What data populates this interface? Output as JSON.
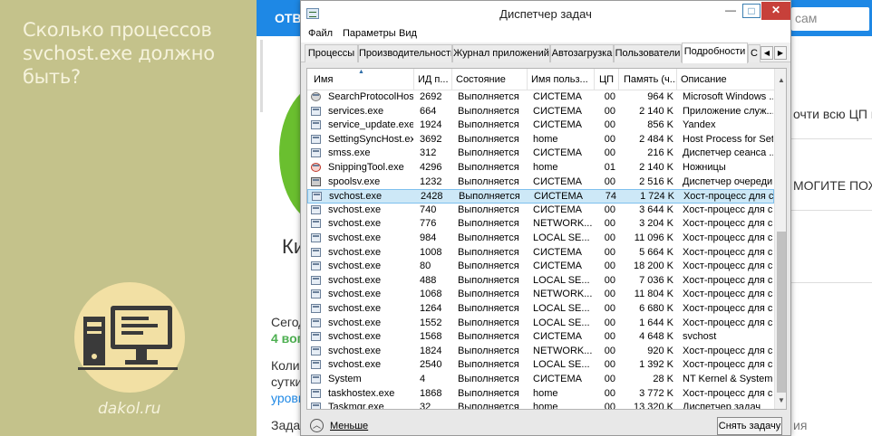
{
  "banner": {
    "title": "Сколько процессов svchost.exe должно быть?",
    "site": "dakol.ru"
  },
  "background_page": {
    "top_button": "ОТВ",
    "search_placeholder": "сам",
    "text_ki": "Ки",
    "text_right_1": "очти всю ЦП гру",
    "text_right_2": "МОГИТЕ ПОЖА",
    "text_left_1": "Сегод",
    "text_left_2": "4 воп",
    "text_left_3": "Колич",
    "text_left_4": "сутки",
    "text_left_5": "уровн",
    "text_left_6": "Задач",
    "text_right_bottom": "ия"
  },
  "window": {
    "title": "Диспетчер задач",
    "min_label": "—",
    "max_label": "□",
    "close_label": "✕",
    "menu": [
      "Файл",
      "Параметры",
      "Вид"
    ],
    "tabs": [
      "Процессы",
      "Производительность",
      "Журнал приложений",
      "Автозагрузка",
      "Пользователи",
      "Подробности",
      "С"
    ],
    "active_tab": "Подробности",
    "columns": [
      "Имя",
      "ИД п...",
      "Состояние",
      "Имя польз...",
      "ЦП",
      "Память (ч...",
      "Описание"
    ],
    "rows": [
      {
        "icon": "search-icon",
        "name": "SearchProtocolHost...",
        "pid": "2692",
        "state": "Выполняется",
        "user": "СИСТЕМА",
        "cpu": "00",
        "mem": "964 K",
        "desc": "Microsoft Windows ..."
      },
      {
        "icon": "process-icon",
        "name": "services.exe",
        "pid": "664",
        "state": "Выполняется",
        "user": "СИСТЕМА",
        "cpu": "00",
        "mem": "2 140 K",
        "desc": "Приложение служ..."
      },
      {
        "icon": "process-icon",
        "name": "service_update.exe",
        "pid": "1924",
        "state": "Выполняется",
        "user": "СИСТЕМА",
        "cpu": "00",
        "mem": "856 K",
        "desc": "Yandex"
      },
      {
        "icon": "process-icon",
        "name": "SettingSyncHost.exe",
        "pid": "3692",
        "state": "Выполняется",
        "user": "home",
        "cpu": "00",
        "mem": "2 484 K",
        "desc": "Host Process for Set..."
      },
      {
        "icon": "process-icon",
        "name": "smss.exe",
        "pid": "312",
        "state": "Выполняется",
        "user": "СИСТЕМА",
        "cpu": "00",
        "mem": "216 K",
        "desc": "Диспетчер сеанса ..."
      },
      {
        "icon": "scissors-icon",
        "name": "SnippingTool.exe",
        "pid": "4296",
        "state": "Выполняется",
        "user": "home",
        "cpu": "01",
        "mem": "2 140 K",
        "desc": "Ножницы"
      },
      {
        "icon": "printer-icon",
        "name": "spoolsv.exe",
        "pid": "1232",
        "state": "Выполняется",
        "user": "СИСТЕМА",
        "cpu": "00",
        "mem": "2 516 K",
        "desc": "Диспетчер очереди..."
      },
      {
        "icon": "process-icon",
        "name": "svchost.exe",
        "pid": "2428",
        "state": "Выполняется",
        "user": "СИСТЕМА",
        "cpu": "74",
        "mem": "1 724 K",
        "desc": "Хост-процесс для с...",
        "selected": true
      },
      {
        "icon": "process-icon",
        "name": "svchost.exe",
        "pid": "740",
        "state": "Выполняется",
        "user": "СИСТЕМА",
        "cpu": "00",
        "mem": "3 644 K",
        "desc": "Хост-процесс для с..."
      },
      {
        "icon": "process-icon",
        "name": "svchost.exe",
        "pid": "776",
        "state": "Выполняется",
        "user": "NETWORK...",
        "cpu": "00",
        "mem": "3 204 K",
        "desc": "Хост-процесс для с..."
      },
      {
        "icon": "process-icon",
        "name": "svchost.exe",
        "pid": "984",
        "state": "Выполняется",
        "user": "LOCAL SE...",
        "cpu": "00",
        "mem": "11 096 K",
        "desc": "Хост-процесс для с..."
      },
      {
        "icon": "process-icon",
        "name": "svchost.exe",
        "pid": "1008",
        "state": "Выполняется",
        "user": "СИСТЕМА",
        "cpu": "00",
        "mem": "5 664 K",
        "desc": "Хост-процесс для с..."
      },
      {
        "icon": "process-icon",
        "name": "svchost.exe",
        "pid": "80",
        "state": "Выполняется",
        "user": "СИСТЕМА",
        "cpu": "00",
        "mem": "18 200 K",
        "desc": "Хост-процесс для с..."
      },
      {
        "icon": "process-icon",
        "name": "svchost.exe",
        "pid": "488",
        "state": "Выполняется",
        "user": "LOCAL SE...",
        "cpu": "00",
        "mem": "7 036 K",
        "desc": "Хост-процесс для с..."
      },
      {
        "icon": "process-icon",
        "name": "svchost.exe",
        "pid": "1068",
        "state": "Выполняется",
        "user": "NETWORK...",
        "cpu": "00",
        "mem": "11 804 K",
        "desc": "Хост-процесс для с..."
      },
      {
        "icon": "process-icon",
        "name": "svchost.exe",
        "pid": "1264",
        "state": "Выполняется",
        "user": "LOCAL SE...",
        "cpu": "00",
        "mem": "6 680 K",
        "desc": "Хост-процесс для с..."
      },
      {
        "icon": "process-icon",
        "name": "svchost.exe",
        "pid": "1552",
        "state": "Выполняется",
        "user": "LOCAL SE...",
        "cpu": "00",
        "mem": "1 644 K",
        "desc": "Хост-процесс для с..."
      },
      {
        "icon": "process-icon",
        "name": "svchost.exe",
        "pid": "1568",
        "state": "Выполняется",
        "user": "СИСТЕМА",
        "cpu": "00",
        "mem": "4 648 K",
        "desc": "svchost"
      },
      {
        "icon": "process-icon",
        "name": "svchost.exe",
        "pid": "1824",
        "state": "Выполняется",
        "user": "NETWORK...",
        "cpu": "00",
        "mem": "920 K",
        "desc": "Хост-процесс для с..."
      },
      {
        "icon": "process-icon",
        "name": "svchost.exe",
        "pid": "2540",
        "state": "Выполняется",
        "user": "LOCAL SE...",
        "cpu": "00",
        "mem": "1 392 K",
        "desc": "Хост-процесс для с..."
      },
      {
        "icon": "process-icon",
        "name": "System",
        "pid": "4",
        "state": "Выполняется",
        "user": "СИСТЕМА",
        "cpu": "00",
        "mem": "28 K",
        "desc": "NT Kernel & System"
      },
      {
        "icon": "process-icon",
        "name": "taskhostex.exe",
        "pid": "1868",
        "state": "Выполняется",
        "user": "home",
        "cpu": "00",
        "mem": "3 772 K",
        "desc": "Хост-процесс для с..."
      },
      {
        "icon": "process-icon",
        "name": "Taskmgr.exe",
        "pid": "32",
        "state": "Выполняется",
        "user": "home",
        "cpu": "00",
        "mem": "13 320 K",
        "desc": "Диспетчер задач"
      }
    ],
    "footer": {
      "fewer_label": "Меньше",
      "end_task_label": "Снять задачу"
    }
  }
}
